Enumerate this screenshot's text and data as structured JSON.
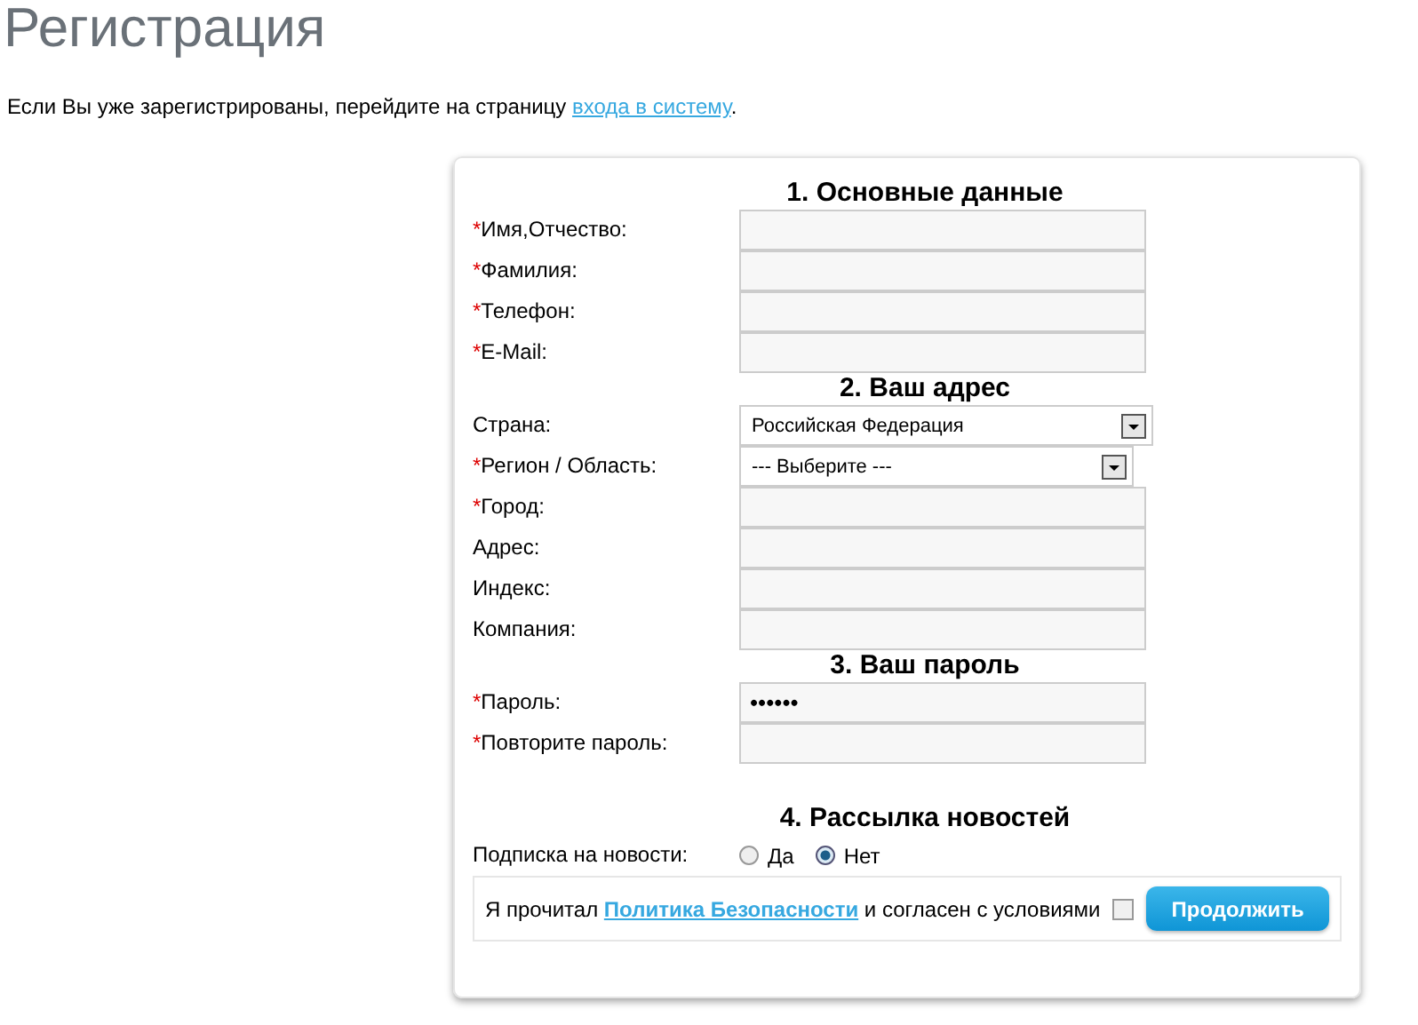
{
  "title": "Регистрация",
  "intro": {
    "text": "Если Вы уже зарегистрированы, перейдите на страницу ",
    "link": "входа в систему",
    "after": "."
  },
  "sections": [
    {
      "heading": "1. Основные данные",
      "fields": [
        {
          "label": "Имя,Отчество:",
          "required_mark": "*",
          "kind": "text"
        },
        {
          "label": "Фамилия:",
          "required_mark": "*",
          "kind": "text"
        },
        {
          "label": "Телефон:",
          "required_mark": "*",
          "kind": "text"
        },
        {
          "label": "E-Mail:",
          "required_mark": "*",
          "kind": "text"
        }
      ]
    },
    {
      "heading": "2. Ваш адрес",
      "fields": [
        {
          "label": "Страна:",
          "kind": "select",
          "value": "Российская Федерация"
        },
        {
          "label": "Регион / Область:",
          "required_mark": "*",
          "kind": "select",
          "value": "--- Выберите ---"
        },
        {
          "label": "Город:",
          "required_mark": "*",
          "kind": "text"
        },
        {
          "label": "Адрес:",
          "kind": "text"
        },
        {
          "label": "Индекс:",
          "kind": "text"
        },
        {
          "label": "Компания:",
          "kind": "text"
        }
      ]
    },
    {
      "heading": "3. Ваш пароль",
      "fields": [
        {
          "label": "Пароль:",
          "required_mark": "*",
          "kind": "password",
          "value": "••••••"
        },
        {
          "label": "Повторите пароль:",
          "required_mark": "*",
          "kind": "password"
        }
      ]
    }
  ],
  "newsletter": {
    "heading": "4. Рассылка новостей",
    "label": "Подписка на новости:",
    "options": [
      {
        "label": "Да",
        "selected": false
      },
      {
        "label": "Нет",
        "selected": true
      }
    ]
  },
  "agreement": {
    "before": "Я прочитал ",
    "link": "Политика Безопасности",
    "after": " и согласен с условиями",
    "checked": false,
    "button": "Продолжить"
  }
}
